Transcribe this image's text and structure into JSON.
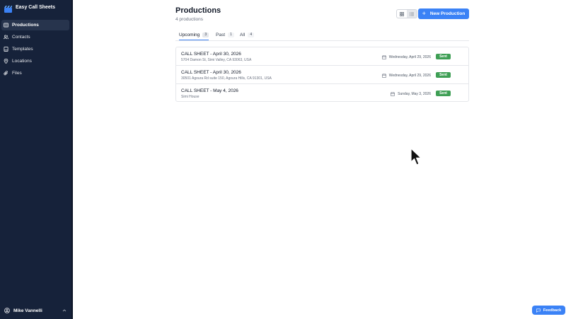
{
  "app": {
    "name": "Easy Call Sheets"
  },
  "sidebar": {
    "items": [
      {
        "label": "Productions",
        "icon": "clapperboard-icon",
        "active": true
      },
      {
        "label": "Contacts",
        "icon": "users-icon",
        "active": false
      },
      {
        "label": "Templates",
        "icon": "book-icon",
        "active": false
      },
      {
        "label": "Locations",
        "icon": "map-pin-icon",
        "active": false
      },
      {
        "label": "Files",
        "icon": "paperclip-icon",
        "active": false
      }
    ],
    "user": {
      "name": "Mike Vannelli"
    }
  },
  "header": {
    "title": "Productions",
    "subtitle": "4 productions",
    "new_button": "New Production"
  },
  "tabs": [
    {
      "label": "Upcoming",
      "count": "3",
      "active": true
    },
    {
      "label": "Past",
      "count": "1",
      "active": false
    },
    {
      "label": "All",
      "count": "4",
      "active": false
    }
  ],
  "productions": [
    {
      "title": "CALL SHEET - April 30, 2026",
      "subtitle": "5704 Damon St, Simi Valley, CA 93063, USA",
      "date": "Wednesday, April 29, 2026",
      "status": "Sent"
    },
    {
      "title": "CALL SHEET - April 30, 2026",
      "subtitle": "30501 Agoura Rd suite 150, Agoura Hills, CA 91301, USA",
      "date": "Wednesday, April 29, 2026",
      "status": "Sent"
    },
    {
      "title": "CALL SHEET - May 4, 2026",
      "subtitle": "Simi House",
      "date": "Sunday, May 3, 2026",
      "status": "Sent"
    }
  ],
  "feedback": {
    "label": "Feedback"
  },
  "colors": {
    "sidebar": "#16223a",
    "accent": "#3b82f6",
    "sent": "#3f9f55"
  }
}
